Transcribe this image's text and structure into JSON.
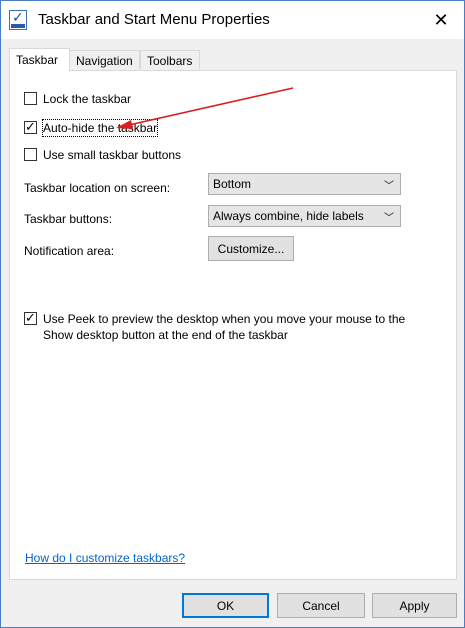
{
  "window": {
    "title": "Taskbar and Start Menu Properties",
    "close_glyph": "✕"
  },
  "tabs": [
    {
      "label": "Taskbar",
      "active": true
    },
    {
      "label": "Navigation",
      "active": false
    },
    {
      "label": "Toolbars",
      "active": false
    }
  ],
  "taskbar": {
    "lock": {
      "label": "Lock the taskbar",
      "checked": false
    },
    "autohide": {
      "label": "Auto-hide the taskbar",
      "checked": true
    },
    "small_buttons": {
      "label": "Use small taskbar buttons",
      "checked": false
    },
    "location": {
      "label": "Taskbar location on screen:",
      "value": "Bottom"
    },
    "buttons": {
      "label": "Taskbar buttons:",
      "value": "Always combine, hide labels"
    },
    "notification": {
      "label": "Notification area:",
      "button": "Customize..."
    },
    "peek": {
      "label": "Use Peek to preview the desktop when you move your mouse to the\nShow desktop button at the end of the taskbar",
      "checked": true
    },
    "help_link": "How do I customize taskbars?"
  },
  "footer": {
    "ok": "OK",
    "cancel": "Cancel",
    "apply": "Apply"
  },
  "icons": {
    "app": "taskbar-properties-icon",
    "check": "✓",
    "dropdown": "﹀"
  },
  "colors": {
    "accent": "#0078d7",
    "link": "#0066cc",
    "annotation_arrow": "#e01b1b"
  }
}
